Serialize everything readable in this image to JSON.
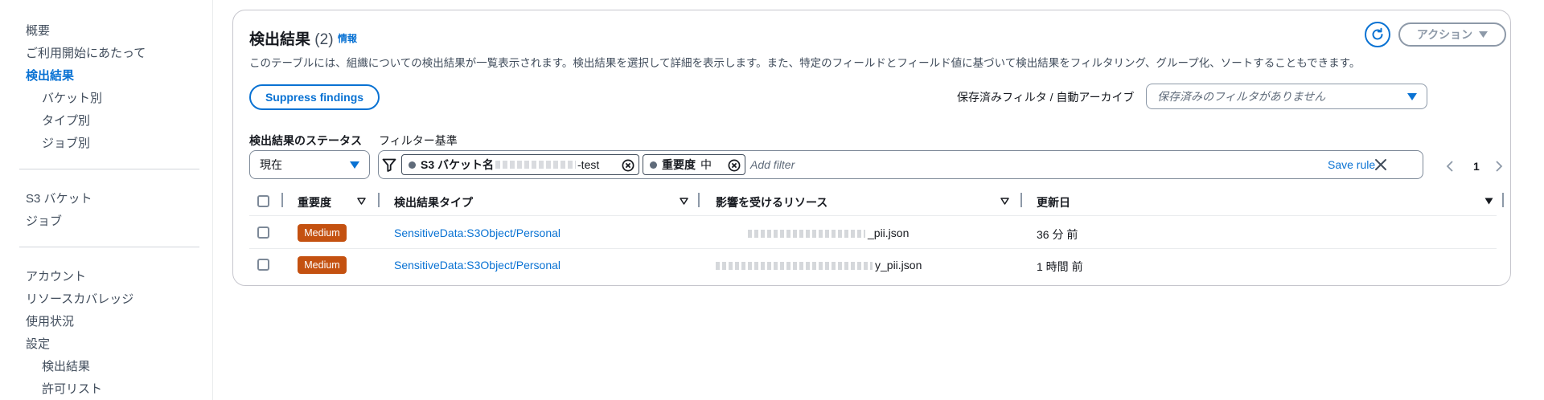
{
  "sidebar": {
    "items": [
      {
        "label": "概要"
      },
      {
        "label": "ご利用開始にあたって"
      },
      {
        "label": "検出結果"
      },
      {
        "label": "バケット別"
      },
      {
        "label": "タイプ別"
      },
      {
        "label": "ジョブ別"
      },
      {
        "label": "S3 バケット"
      },
      {
        "label": "ジョブ"
      },
      {
        "label": "アカウント"
      },
      {
        "label": "リソースカバレッジ"
      },
      {
        "label": "使用状況"
      },
      {
        "label": "設定"
      },
      {
        "label": "検出結果"
      },
      {
        "label": "許可リスト"
      }
    ]
  },
  "panel": {
    "title": "検出結果",
    "count": "(2)",
    "info_link": "情報",
    "description": "このテーブルには、組織についての検出結果が一覧表示されます。検出結果を選択して詳細を表示します。また、特定のフィールドとフィールド値に基づいて検出結果をフィルタリング、グループ化、ソートすることもできます。",
    "actions_label": "アクション",
    "suppress_label": "Suppress findings",
    "saved_filter_label": "保存済みフィルタ / 自動アーカイブ",
    "saved_filter_placeholder": "保存済みのフィルタがありません",
    "status_label": "検出結果のステータス",
    "status_value": "現在",
    "filter_label": "フィルター基準",
    "filter_tokens": [
      {
        "key": "S3 バケット名",
        "value": "-test"
      },
      {
        "key": "重要度",
        "value": "中"
      }
    ],
    "add_filter_placeholder": "Add filter",
    "save_rule_label": "Save rule",
    "page_number": "1"
  },
  "table": {
    "columns": [
      "重要度",
      "検出結果タイプ",
      "影響を受けるリソース",
      "更新日"
    ],
    "rows": [
      {
        "severity": "Medium",
        "type": "SensitiveData:S3Object/Personal",
        "resource": "_pii.json",
        "updated": "36 分 前"
      },
      {
        "severity": "Medium",
        "type": "SensitiveData:S3Object/Personal",
        "resource": "y_pii.json",
        "updated": "1 時間 前"
      }
    ]
  },
  "colors": {
    "link": "#0972d3",
    "severity_medium": "#c45110",
    "border": "#c6c6cd"
  }
}
